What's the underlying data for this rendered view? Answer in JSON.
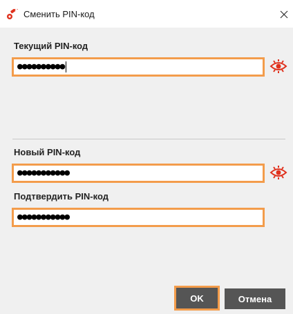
{
  "window": {
    "title": "Сменить PIN-код",
    "icon": "key-icon",
    "close_glyph": "✕"
  },
  "current_pin": {
    "label": "Текущий PIN-код",
    "masked_value": "●●●●●●●●●●",
    "show_icon": "eye-icon"
  },
  "new_pin": {
    "label": "Новый PIN-код",
    "masked_value": "●●●●●●●●●●●",
    "show_icon": "eye-icon"
  },
  "confirm_pin": {
    "label": "Подтвердить PIN-код",
    "masked_value": "●●●●●●●●●●●"
  },
  "buttons": {
    "ok_label": "OK",
    "cancel_label": "Отмена"
  },
  "colors": {
    "highlight": "#f39c4b",
    "accent_icon": "#e0311d",
    "button_bg": "#555555"
  }
}
